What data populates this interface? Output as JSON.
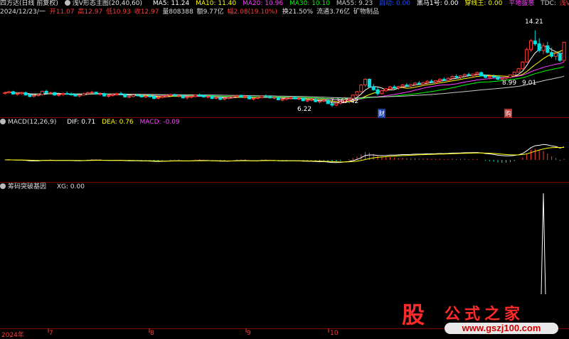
{
  "colors": {
    "up": "#ff3c3c",
    "down": "#00e0e0",
    "ma5": "#ffffff",
    "ma10": "#ffff00",
    "ma20": "#ff40ff",
    "ma30": "#00ff00",
    "ma55": "#c8c8c8",
    "grid": "#7a0000",
    "watermark": "#ff2a2a"
  },
  "header": {
    "title": "四方达(日线 前复权)",
    "indicator": "浅V形态主图(20,40,60)",
    "ma5": "MA5: 11.24",
    "ma10": "MA10: 11.40",
    "ma20": "MA20: 10.96",
    "ma30": "MA30: 10.10",
    "ma55": "MA55: 9.23",
    "qidong": "启动: 0.00",
    "heima": "黑马1号: 0.00",
    "chuanxian": "穿线王: 0.00",
    "pingdi": "平地拔葱",
    "tdc": "TDC:",
    "tdc_val": "浅V形态"
  },
  "info": {
    "date": "2024/12/23/一",
    "open": "开11.07",
    "high": "高12.97",
    "low": "低10.93",
    "close": "收12.97",
    "vol": "量808388",
    "amount": "额9.77亿",
    "change": "幅2.08(19.10%)",
    "turnover": "换21.50%",
    "float": "流通3.76亿",
    "sector": "矿物制品"
  },
  "macd_header": {
    "name": "MACD(12,26,9)",
    "dif": "DIF: 0.71",
    "dea": "DEA: 0.76",
    "macd": "MACD: -0.09"
  },
  "xg_header": {
    "name": "筹码突破基因",
    "xg": "XG: 0.00"
  },
  "price_labels": {
    "high": "14.21",
    "low": "6.22",
    "mid1": "7.36",
    "mid2": "7.42",
    "r1": "8.99",
    "r2": "9.01",
    "cai": "财",
    "gou": "购"
  },
  "time_axis": [
    "2024年",
    "7",
    "8",
    "9",
    "10"
  ],
  "watermark": {
    "gu": "股",
    "title": "公式之家",
    "url": "www.gszj100.com"
  },
  "chart_data": {
    "type": "candlestick",
    "title": "四方达(日线 前复权)",
    "main_ylim": [
      5.5,
      15.6
    ],
    "candles": [
      [
        7.6,
        7.8,
        7.5,
        7.7
      ],
      [
        7.7,
        7.9,
        7.6,
        7.8
      ],
      [
        7.8,
        7.9,
        7.5,
        7.55
      ],
      [
        7.55,
        7.7,
        7.4,
        7.6
      ],
      [
        7.6,
        7.8,
        7.5,
        7.7
      ],
      [
        7.7,
        7.8,
        7.4,
        7.45
      ],
      [
        7.45,
        7.6,
        7.2,
        7.3
      ],
      [
        7.3,
        7.5,
        7.2,
        7.4
      ],
      [
        7.4,
        7.6,
        7.3,
        7.5
      ],
      [
        7.5,
        7.9,
        7.4,
        7.85
      ],
      [
        7.85,
        8.0,
        7.6,
        7.65
      ],
      [
        7.65,
        7.8,
        7.5,
        7.7
      ],
      [
        7.7,
        7.8,
        7.4,
        7.45
      ],
      [
        7.45,
        7.6,
        7.3,
        7.5
      ],
      [
        7.5,
        7.7,
        7.4,
        7.6
      ],
      [
        7.6,
        7.8,
        7.5,
        7.55
      ],
      [
        7.55,
        7.7,
        7.4,
        7.5
      ],
      [
        7.5,
        7.6,
        7.3,
        7.35
      ],
      [
        7.35,
        7.5,
        7.2,
        7.45
      ],
      [
        7.45,
        7.7,
        7.4,
        7.6
      ],
      [
        7.6,
        7.8,
        7.5,
        7.7
      ],
      [
        7.7,
        7.9,
        7.6,
        7.75
      ],
      [
        7.75,
        7.8,
        7.5,
        7.55
      ],
      [
        7.55,
        7.7,
        7.4,
        7.6
      ],
      [
        7.6,
        7.7,
        7.3,
        7.35
      ],
      [
        7.35,
        7.5,
        7.2,
        7.4
      ],
      [
        7.4,
        7.6,
        7.3,
        7.5
      ],
      [
        7.5,
        7.7,
        7.4,
        7.6
      ],
      [
        7.6,
        7.8,
        7.5,
        7.55
      ],
      [
        7.55,
        7.6,
        7.2,
        7.25
      ],
      [
        7.25,
        7.4,
        7.1,
        7.3
      ],
      [
        7.3,
        7.5,
        7.2,
        7.45
      ],
      [
        7.45,
        7.6,
        7.3,
        7.4
      ],
      [
        7.4,
        7.5,
        7.2,
        7.25
      ],
      [
        7.25,
        7.4,
        7.1,
        7.35
      ],
      [
        7.35,
        7.5,
        7.2,
        7.3
      ],
      [
        7.3,
        7.4,
        7.0,
        7.1
      ],
      [
        7.1,
        7.3,
        7.0,
        7.2
      ],
      [
        7.2,
        7.4,
        7.1,
        7.3
      ],
      [
        7.3,
        7.5,
        7.2,
        7.4
      ],
      [
        7.4,
        7.6,
        7.3,
        7.5
      ],
      [
        7.5,
        7.6,
        7.3,
        7.35
      ],
      [
        7.35,
        7.5,
        7.2,
        7.4
      ],
      [
        7.4,
        7.5,
        7.1,
        7.15
      ],
      [
        7.15,
        7.3,
        7.0,
        7.25
      ],
      [
        7.25,
        7.4,
        7.1,
        7.3
      ],
      [
        7.3,
        7.5,
        7.2,
        7.45
      ],
      [
        7.45,
        7.6,
        7.3,
        7.4
      ],
      [
        7.4,
        7.5,
        7.2,
        7.25
      ],
      [
        7.25,
        7.4,
        7.1,
        7.3
      ],
      [
        7.3,
        7.4,
        7.0,
        7.1
      ],
      [
        7.1,
        7.3,
        7.0,
        7.2
      ],
      [
        7.2,
        7.3,
        6.9,
        7.0
      ],
      [
        7.0,
        7.2,
        6.9,
        7.1
      ],
      [
        7.1,
        7.3,
        7.0,
        7.2
      ],
      [
        7.2,
        7.4,
        7.1,
        7.3
      ],
      [
        7.3,
        7.5,
        7.2,
        7.4
      ],
      [
        7.4,
        7.5,
        7.2,
        7.25
      ],
      [
        7.25,
        7.4,
        7.1,
        7.3
      ],
      [
        7.3,
        7.4,
        7.0,
        7.05
      ],
      [
        7.05,
        7.2,
        6.9,
        7.1
      ],
      [
        7.1,
        7.3,
        7.0,
        7.2
      ],
      [
        7.2,
        7.4,
        7.1,
        7.35
      ],
      [
        7.35,
        7.5,
        7.2,
        7.3
      ],
      [
        7.3,
        7.4,
        7.1,
        7.15
      ],
      [
        7.15,
        7.3,
        7.0,
        7.2
      ],
      [
        7.2,
        7.3,
        6.9,
        6.95
      ],
      [
        6.95,
        7.1,
        6.8,
        7.0
      ],
      [
        7.0,
        7.2,
        6.9,
        7.1
      ],
      [
        7.1,
        7.3,
        7.0,
        7.2
      ],
      [
        7.2,
        7.3,
        7.0,
        7.05
      ],
      [
        7.05,
        7.2,
        6.9,
        7.1
      ],
      [
        7.1,
        7.2,
        6.8,
        6.85
      ],
      [
        6.85,
        7.0,
        6.7,
        6.9
      ],
      [
        6.9,
        7.1,
        6.8,
        7.0
      ],
      [
        7.0,
        7.1,
        6.7,
        6.75
      ],
      [
        6.75,
        6.9,
        6.6,
        6.8
      ],
      [
        6.8,
        7.0,
        6.7,
        6.9
      ],
      [
        6.9,
        7.0,
        6.5,
        6.55
      ],
      [
        6.55,
        6.7,
        6.22,
        6.4
      ],
      [
        6.4,
        6.7,
        6.3,
        6.6
      ],
      [
        6.6,
        6.9,
        6.5,
        6.8
      ],
      [
        6.8,
        7.0,
        6.7,
        6.95
      ],
      [
        6.95,
        7.1,
        6.8,
        7.05
      ],
      [
        7.05,
        7.5,
        7.0,
        7.45
      ],
      [
        7.45,
        7.9,
        7.36,
        7.8
      ],
      [
        7.8,
        8.6,
        7.7,
        8.5
      ],
      [
        8.5,
        9.2,
        8.3,
        9.1
      ],
      [
        9.1,
        9.2,
        8.2,
        8.3
      ],
      [
        8.3,
        8.6,
        7.9,
        8.0
      ],
      [
        8.0,
        8.3,
        7.42,
        7.6
      ],
      [
        7.6,
        8.0,
        7.5,
        7.9
      ],
      [
        7.9,
        8.2,
        7.8,
        8.1
      ],
      [
        8.1,
        8.4,
        8.0,
        8.3
      ],
      [
        8.3,
        8.5,
        8.1,
        8.2
      ],
      [
        8.2,
        8.4,
        8.0,
        8.35
      ],
      [
        8.35,
        8.6,
        8.2,
        8.5
      ],
      [
        8.5,
        8.7,
        8.3,
        8.4
      ],
      [
        8.4,
        8.6,
        8.2,
        8.55
      ],
      [
        8.55,
        8.8,
        8.4,
        8.7
      ],
      [
        8.7,
        8.9,
        8.5,
        8.6
      ],
      [
        8.6,
        8.8,
        8.4,
        8.75
      ],
      [
        8.75,
        9.0,
        8.6,
        8.9
      ],
      [
        8.9,
        9.1,
        8.7,
        8.8
      ],
      [
        8.8,
        9.0,
        8.6,
        8.95
      ],
      [
        8.95,
        9.2,
        8.8,
        9.1
      ],
      [
        9.1,
        9.3,
        8.9,
        9.0
      ],
      [
        9.0,
        9.3,
        8.9,
        9.2
      ],
      [
        9.2,
        9.5,
        9.1,
        9.4
      ],
      [
        9.4,
        9.6,
        9.2,
        9.3
      ],
      [
        9.3,
        9.5,
        9.1,
        9.45
      ],
      [
        9.45,
        9.7,
        9.3,
        9.6
      ],
      [
        9.6,
        9.8,
        9.4,
        9.5
      ],
      [
        9.5,
        9.7,
        9.3,
        9.65
      ],
      [
        9.65,
        9.9,
        9.5,
        9.8
      ],
      [
        9.8,
        9.9,
        9.4,
        9.45
      ],
      [
        9.45,
        9.6,
        9.2,
        9.3
      ],
      [
        9.3,
        9.5,
        9.1,
        9.4
      ],
      [
        9.4,
        9.6,
        9.2,
        9.35
      ],
      [
        9.35,
        9.5,
        9.0,
        9.1
      ],
      [
        9.1,
        9.3,
        8.99,
        9.2
      ],
      [
        9.2,
        9.4,
        9.01,
        9.3
      ],
      [
        9.3,
        9.6,
        9.2,
        9.55
      ],
      [
        9.55,
        9.9,
        9.5,
        9.85
      ],
      [
        9.85,
        10.3,
        9.8,
        10.2
      ],
      [
        10.2,
        11.0,
        10.1,
        10.9
      ],
      [
        10.9,
        12.4,
        10.8,
        12.2
      ],
      [
        12.2,
        13.3,
        12.0,
        13.1
      ],
      [
        13.1,
        14.21,
        12.6,
        12.8
      ],
      [
        12.8,
        13.4,
        11.9,
        12.1
      ],
      [
        12.1,
        12.9,
        11.7,
        12.6
      ],
      [
        12.6,
        13.0,
        11.8,
        11.9
      ],
      [
        11.9,
        12.4,
        11.3,
        11.5
      ],
      [
        11.5,
        12.0,
        11.1,
        11.8
      ],
      [
        11.8,
        12.1,
        10.93,
        11.07
      ],
      [
        11.07,
        12.97,
        10.93,
        12.97
      ]
    ],
    "macd_ylim": [
      -1.2,
      2.0
    ],
    "xg_ylim": [
      0,
      1
    ]
  }
}
